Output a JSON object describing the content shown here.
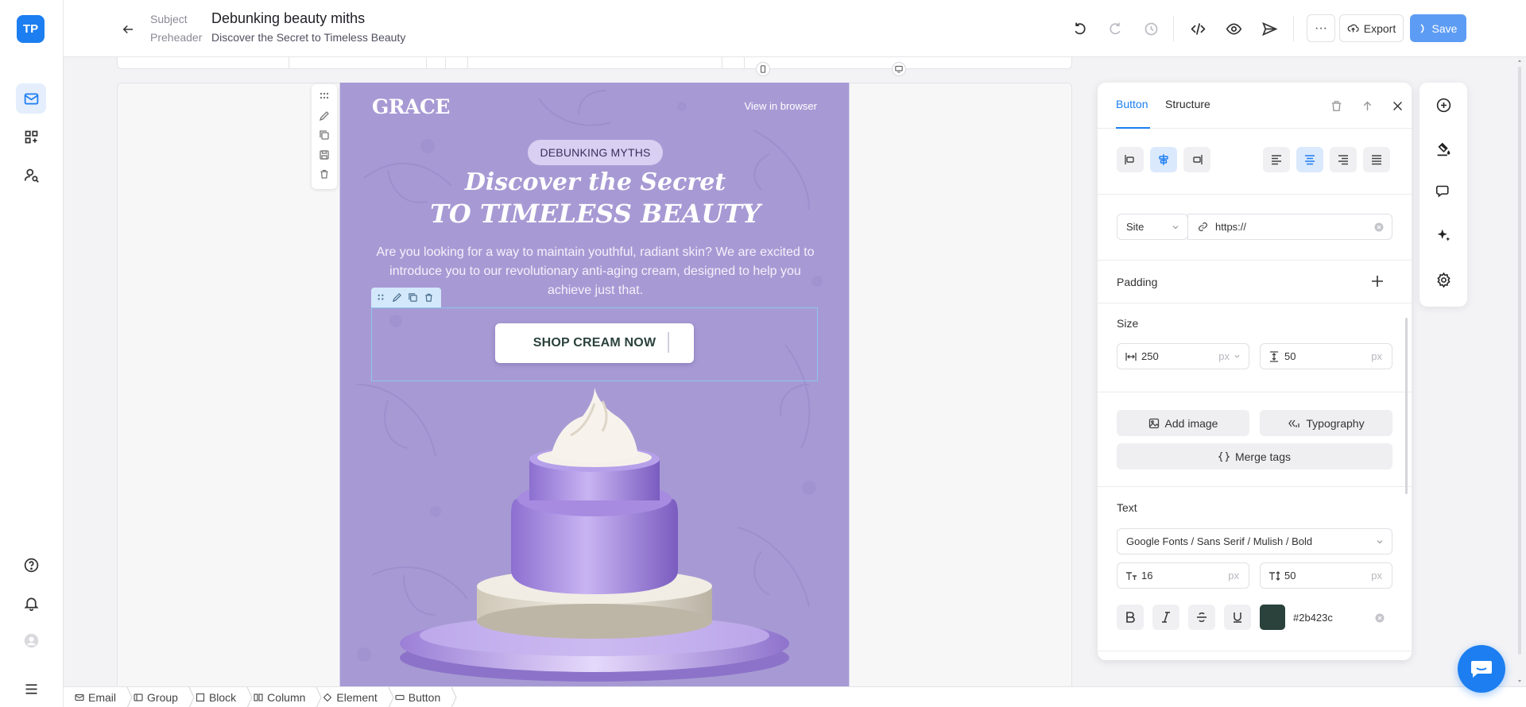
{
  "app": {
    "logo_text": "TP"
  },
  "header": {
    "subject_label": "Subject",
    "subject_value": "Debunking beauty miths",
    "preheader_label": "Preheader",
    "preheader_value": "Discover the Secret to Timeless Beauty",
    "export_label": "Export",
    "save_label": "Save",
    "more_label": "···"
  },
  "email": {
    "brand": "GRACE",
    "view_in_browser": "View in browser",
    "badge": "DEBUNKING MYTHS",
    "hero_line1": "Discover the Secret",
    "hero_line2": "TO TIMELESS BEAUTY",
    "intro": "Are you looking for a way to maintain youthful, radiant skin? We are excited to introduce you to our revolutionary anti-aging cream, designed to help you achieve just that.",
    "cta_label": "SHOP CREAM NOW",
    "background_color": "#a79ad4"
  },
  "breadcrumbs": [
    {
      "label": "Email",
      "icon": "mail-icon"
    },
    {
      "label": "Group",
      "icon": "group-icon"
    },
    {
      "label": "Block",
      "icon": "block-icon"
    },
    {
      "label": "Column",
      "icon": "column-icon"
    },
    {
      "label": "Element",
      "icon": "element-icon"
    },
    {
      "label": "Button",
      "icon": "button-icon"
    }
  ],
  "panel": {
    "tabs": [
      {
        "label": "Button",
        "active": true
      },
      {
        "label": "Structure",
        "active": false
      }
    ],
    "link_type": "Site",
    "link_value": "https://",
    "padding_label": "Padding",
    "size_label": "Size",
    "width_value": "250",
    "width_unit": "px",
    "height_value": "50",
    "height_unit": "px",
    "add_image_label": "Add image",
    "typography_label": "Typography",
    "merge_tags_label": "Merge tags",
    "text_label": "Text",
    "font_value": "Google Fonts / Sans Serif / Mulish / Bold",
    "font_size_value": "16",
    "font_size_unit": "px",
    "line_height_value": "50",
    "line_height_unit": "px",
    "text_color": "#2b423c"
  },
  "colors": {
    "accent": "#1c7ef0",
    "save_button": "#5d9cf5",
    "email_bg": "#a79ad4",
    "button_text": "#2b423c"
  }
}
